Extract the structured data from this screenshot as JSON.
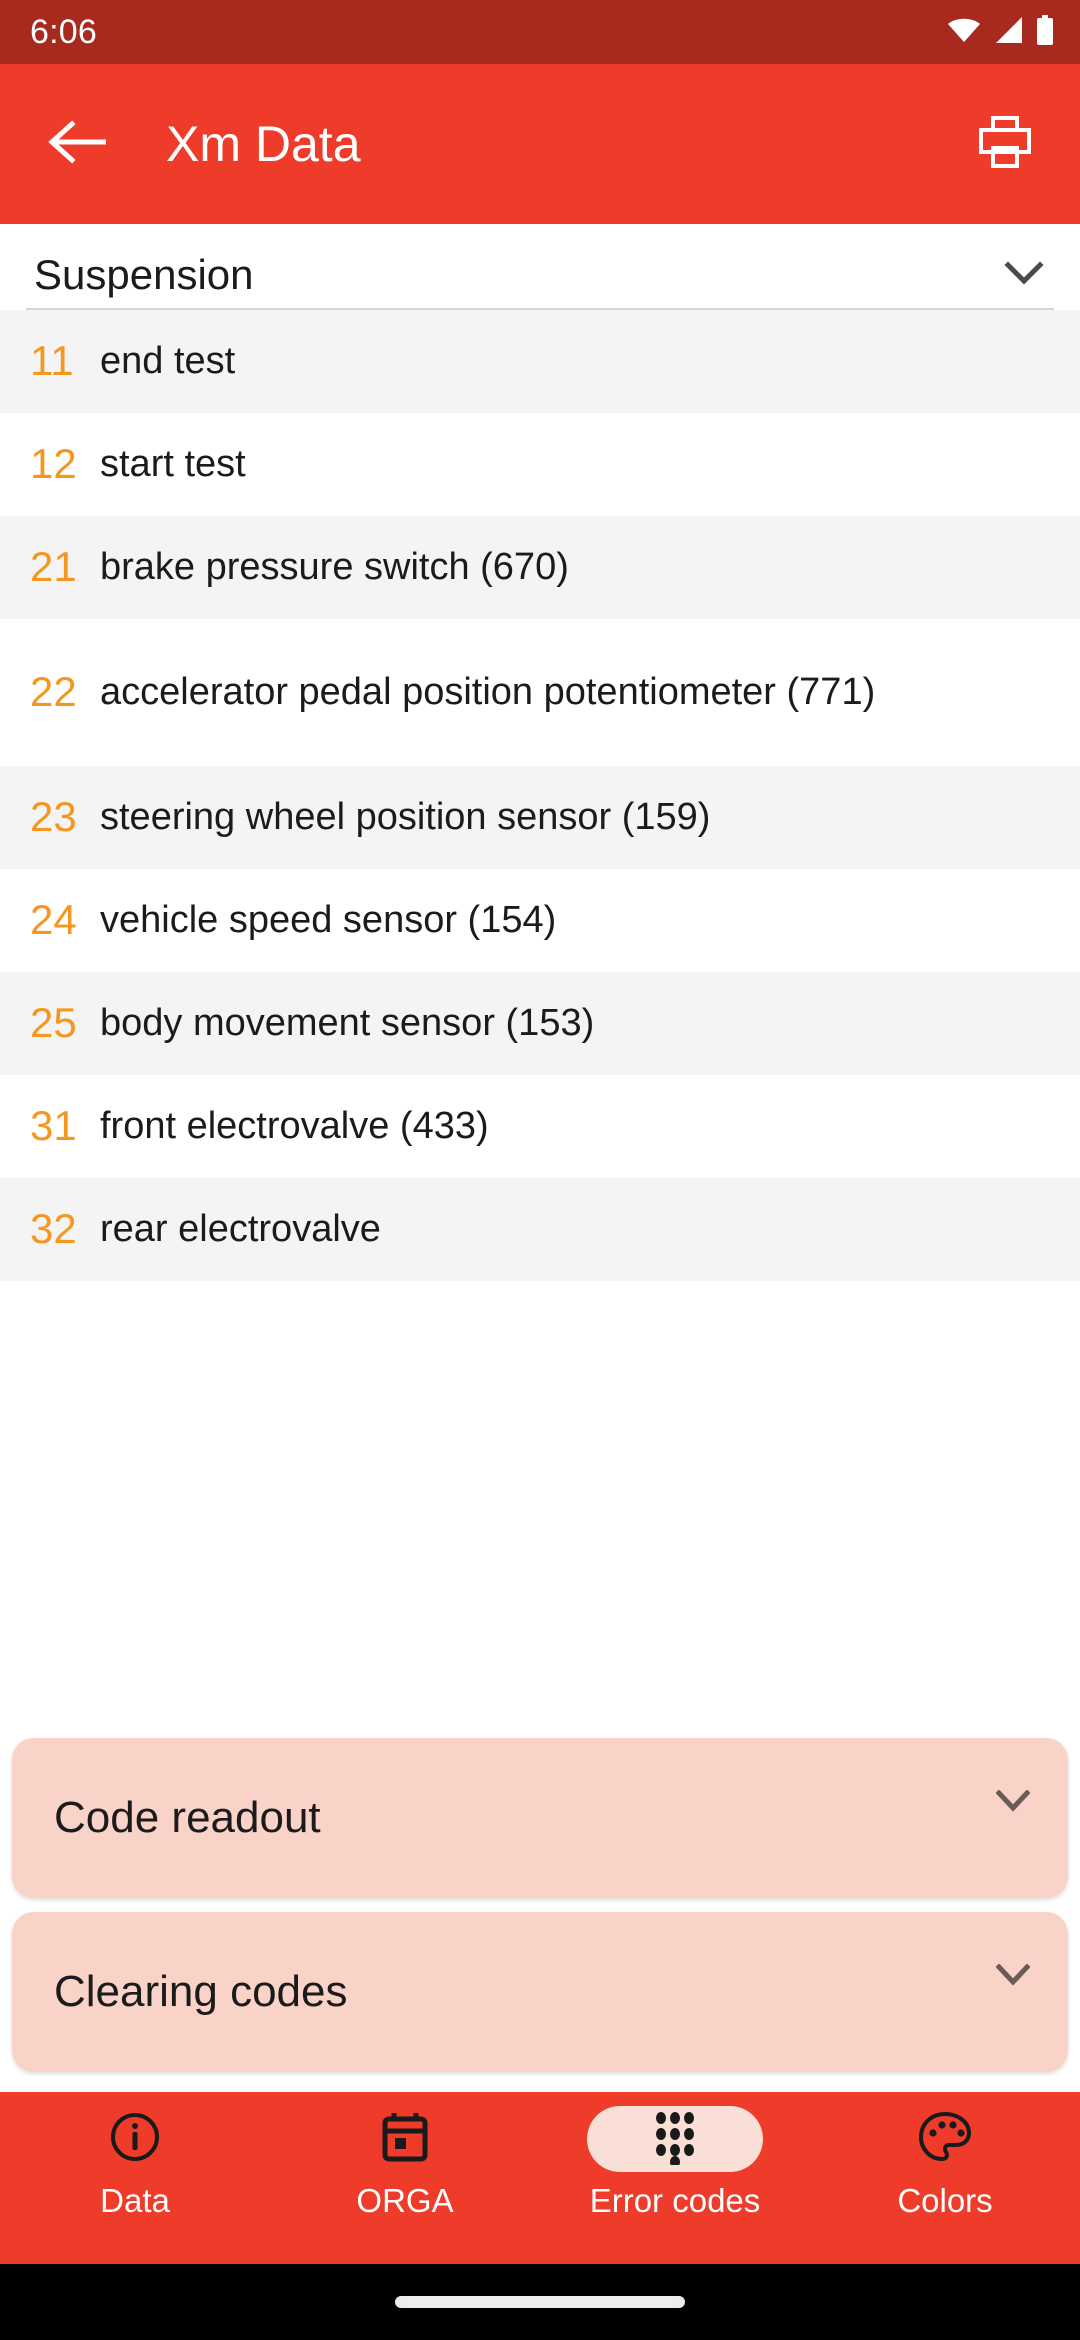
{
  "theme": {
    "accent": "#ee3b2a",
    "status_bar": "#a8291d",
    "number_color": "#f5971f",
    "card_bg": "#f9d3c8",
    "row_alt_bg": "#f4f4f4"
  },
  "status_bar": {
    "time": "6:06",
    "icons": [
      "wifi-icon",
      "cellular-signal-icon",
      "battery-icon"
    ]
  },
  "app_bar": {
    "back_icon": "arrow-left-icon",
    "title": "Xm Data",
    "print_icon": "printer-icon"
  },
  "selector": {
    "label": "Suspension",
    "chevron_icon": "chevron-down-icon"
  },
  "list": {
    "rows": [
      {
        "number": "11",
        "label": "end test"
      },
      {
        "number": "12",
        "label": "start test"
      },
      {
        "number": "21",
        "label": "brake pressure switch (670)"
      },
      {
        "number": "22",
        "label": "accelerator pedal position potentiometer (771)"
      },
      {
        "number": "23",
        "label": "steering wheel position sensor (159)"
      },
      {
        "number": "24",
        "label": "vehicle speed sensor (154)"
      },
      {
        "number": "25",
        "label": "body movement sensor (153)"
      },
      {
        "number": "31",
        "label": "front electrovalve (433)"
      },
      {
        "number": "32",
        "label": "rear electrovalve"
      }
    ]
  },
  "cards": [
    {
      "label": "Code readout",
      "chevron_icon": "chevron-down-icon"
    },
    {
      "label": "Clearing codes",
      "chevron_icon": "chevron-down-icon"
    }
  ],
  "bottom_nav": {
    "items": [
      {
        "label": "Data",
        "icon": "info-circle-icon",
        "active": false
      },
      {
        "label": "ORGA",
        "icon": "calendar-icon",
        "active": false
      },
      {
        "label": "Error codes",
        "icon": "dialpad-grid-icon",
        "active": true
      },
      {
        "label": "Colors",
        "icon": "palette-icon",
        "active": false
      }
    ]
  }
}
